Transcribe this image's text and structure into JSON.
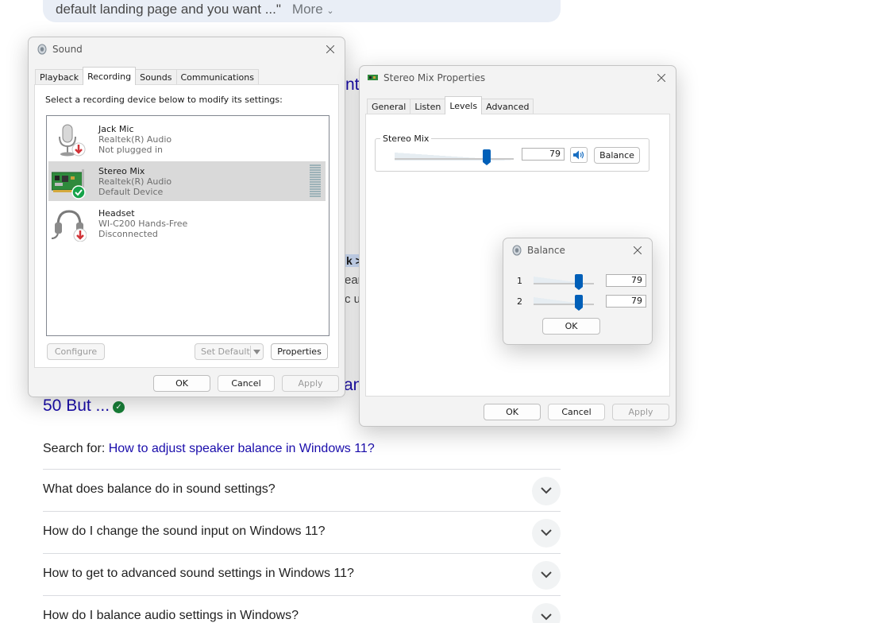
{
  "background": {
    "snippet_text": "default landing page and you want ...\"",
    "snippet_more": "More",
    "peeks": [
      "nt",
      "k >",
      "ear",
      "c u",
      "an"
    ],
    "result_title": "50 But ...",
    "search_for_label": "Search for:",
    "search_for_link": "How to adjust speaker balance in Windows 11?",
    "questions": [
      "What does balance do in sound settings?",
      "How do I change the sound input on Windows 11?",
      "How to get to advanced sound settings in Windows 11?",
      "How do I balance audio settings in Windows?"
    ]
  },
  "sound_dialog": {
    "title": "Sound",
    "tabs": [
      "Playback",
      "Recording",
      "Sounds",
      "Communications"
    ],
    "active_tab": "Recording",
    "instruction": "Select a recording device below to modify its settings:",
    "devices": [
      {
        "name": "Jack Mic",
        "driver": "Realtek(R) Audio",
        "status": "Not plugged in",
        "icon": "microphone-icon",
        "badge": "down-arrow-badge"
      },
      {
        "name": "Stereo Mix",
        "driver": "Realtek(R) Audio",
        "status": "Default Device",
        "icon": "sound-card-icon",
        "badge": "checkmark-badge",
        "selected": true
      },
      {
        "name": "Headset",
        "driver": "WI-C200 Hands-Free",
        "status": "Disconnected",
        "icon": "headset-icon",
        "badge": "down-arrow-badge"
      }
    ],
    "buttons": {
      "configure": "Configure",
      "set_default": "Set Default",
      "properties": "Properties",
      "ok": "OK",
      "cancel": "Cancel",
      "apply": "Apply"
    }
  },
  "stereo_mix_properties": {
    "title": "Stereo Mix Properties",
    "tabs": [
      "General",
      "Listen",
      "Levels",
      "Advanced"
    ],
    "active_tab": "Levels",
    "group_label": "Stereo Mix",
    "level": 79,
    "level_max": 100,
    "speaker_icon": "speaker-icon",
    "balance_button": "Balance",
    "buttons": {
      "ok": "OK",
      "cancel": "Cancel",
      "apply": "Apply"
    }
  },
  "balance_dialog": {
    "title": "Balance",
    "channels": [
      {
        "label": "1",
        "value": 79
      },
      {
        "label": "2",
        "value": 79
      }
    ],
    "ok": "OK"
  },
  "colors": {
    "accent": "#005fb8",
    "link": "#1a0dab",
    "selection": "#d9d9d9",
    "verified_green": "#188038"
  }
}
